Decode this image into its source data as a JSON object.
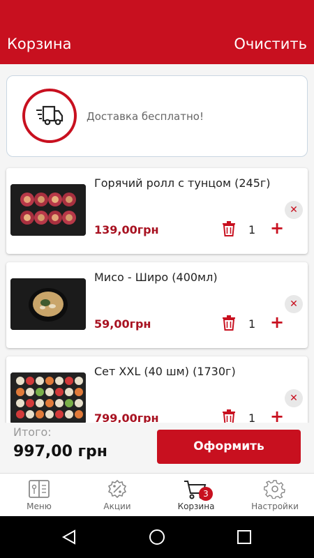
{
  "header": {
    "title": "Корзина",
    "clear_label": "Очистить"
  },
  "delivery": {
    "text": "Доставка бесплатно!",
    "icon": "delivery-truck-icon"
  },
  "items": [
    {
      "name": "Горячий ролл с тунцом (245г)",
      "price": "139,00грн",
      "qty": "1"
    },
    {
      "name": "Мисо - Широ (400мл)",
      "price": "59,00грн",
      "qty": "1"
    },
    {
      "name": "Сет XXL (40 шм) (1730г)",
      "price": "799,00грн",
      "qty": "1"
    }
  ],
  "controls": {
    "plus": "+",
    "remove": "✕",
    "trash_icon": "trash-icon"
  },
  "total": {
    "label": "Итого:",
    "value": "997,00 грн"
  },
  "checkout": {
    "label": "Оформить"
  },
  "nav": {
    "items": [
      {
        "label": "Меню",
        "icon": "menu-book-icon"
      },
      {
        "label": "Акции",
        "icon": "discount-badge-icon"
      },
      {
        "label": "Корзина",
        "icon": "cart-icon",
        "badge": "3"
      },
      {
        "label": "Настройки",
        "icon": "gear-icon"
      }
    ]
  },
  "colors": {
    "accent": "#c8101f",
    "price": "#a81221"
  }
}
